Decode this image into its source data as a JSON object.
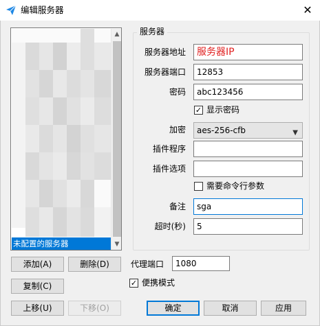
{
  "window": {
    "title": "编辑服务器",
    "close_glyph": "✕"
  },
  "server_list": {
    "selected_item": "未配置的服务器"
  },
  "server_group": {
    "legend": "服务器",
    "address_label": "服务器地址",
    "address_value": "服务器IP",
    "port_label": "服务器端口",
    "port_value": "12853",
    "password_label": "密码",
    "password_value": "abc123456",
    "show_password_label": "显示密码",
    "show_password_checked": true,
    "encryption_label": "加密",
    "encryption_value": "aes-256-cfb",
    "plugin_label": "插件程序",
    "plugin_value": "",
    "plugin_options_label": "插件选项",
    "plugin_options_value": "",
    "needs_cmdline_label": "需要命令行参数",
    "needs_cmdline_checked": false,
    "remarks_label": "备注",
    "remarks_value": "sga",
    "timeout_label": "超时(秒)",
    "timeout_value": "5"
  },
  "list_buttons": {
    "add": "添加(A)",
    "delete": "删除(D)",
    "copy": "复制(C)",
    "move_up": "上移(U)",
    "move_down": "下移(O)"
  },
  "proxy": {
    "port_label": "代理端口",
    "port_value": "1080",
    "portable_label": "便携模式",
    "portable_checked": true
  },
  "dialog_buttons": {
    "ok": "确定",
    "cancel": "取消",
    "apply": "应用"
  },
  "colors": {
    "accent": "#0078d7",
    "address_text": "#e02020",
    "titlebar_icon": "#1e88e5"
  }
}
